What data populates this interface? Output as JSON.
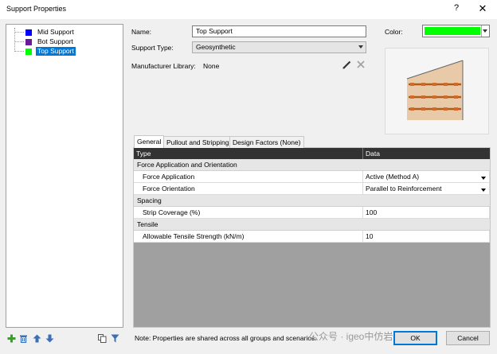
{
  "window": {
    "title": "Support Properties",
    "help": "?",
    "close": "✕"
  },
  "tree": {
    "items": [
      {
        "label": "Mid Support",
        "color": "#0000ff"
      },
      {
        "label": "Bot Support",
        "color": "#6a1b9a"
      },
      {
        "label": "Top Support",
        "color": "#00ff00",
        "selected": true
      }
    ]
  },
  "toolbar_icons": [
    "add-icon",
    "delete-icon",
    "move-up-icon",
    "move-down-icon",
    "copy-icon",
    "filter-icon"
  ],
  "form": {
    "name_label": "Name:",
    "name_value": "Top Support",
    "type_label": "Support Type:",
    "type_value": "Geosynthetic",
    "manufacturer_label": "Manufacturer Library:",
    "manufacturer_value": "None",
    "color_label": "Color:",
    "color_value": "#00ff00"
  },
  "tabs": [
    {
      "label": "General",
      "active": true
    },
    {
      "label": "Pullout and Stripping"
    },
    {
      "label": "Design Factors (None)"
    }
  ],
  "grid": {
    "headers": {
      "type": "Type",
      "data": "Data"
    },
    "sections": [
      {
        "category": "Force Application and Orientation",
        "rows": [
          {
            "name": "Force Application",
            "value": "Active (Method A)",
            "dropdown": true
          },
          {
            "name": "Force Orientation",
            "value": "Parallel to Reinforcement",
            "dropdown": true
          }
        ]
      },
      {
        "category": "Spacing",
        "rows": [
          {
            "name": "Strip Coverage (%)",
            "value": "100"
          }
        ]
      },
      {
        "category": "Tensile",
        "rows": [
          {
            "name": "Allowable Tensile Strength (kN/m)",
            "value": "10"
          }
        ]
      }
    ]
  },
  "footer": {
    "note": "Note: Properties are shared across all groups and scenarios.",
    "ok": "OK",
    "cancel": "Cancel"
  },
  "watermark": "公众号 · igeo中仿岩土软件"
}
